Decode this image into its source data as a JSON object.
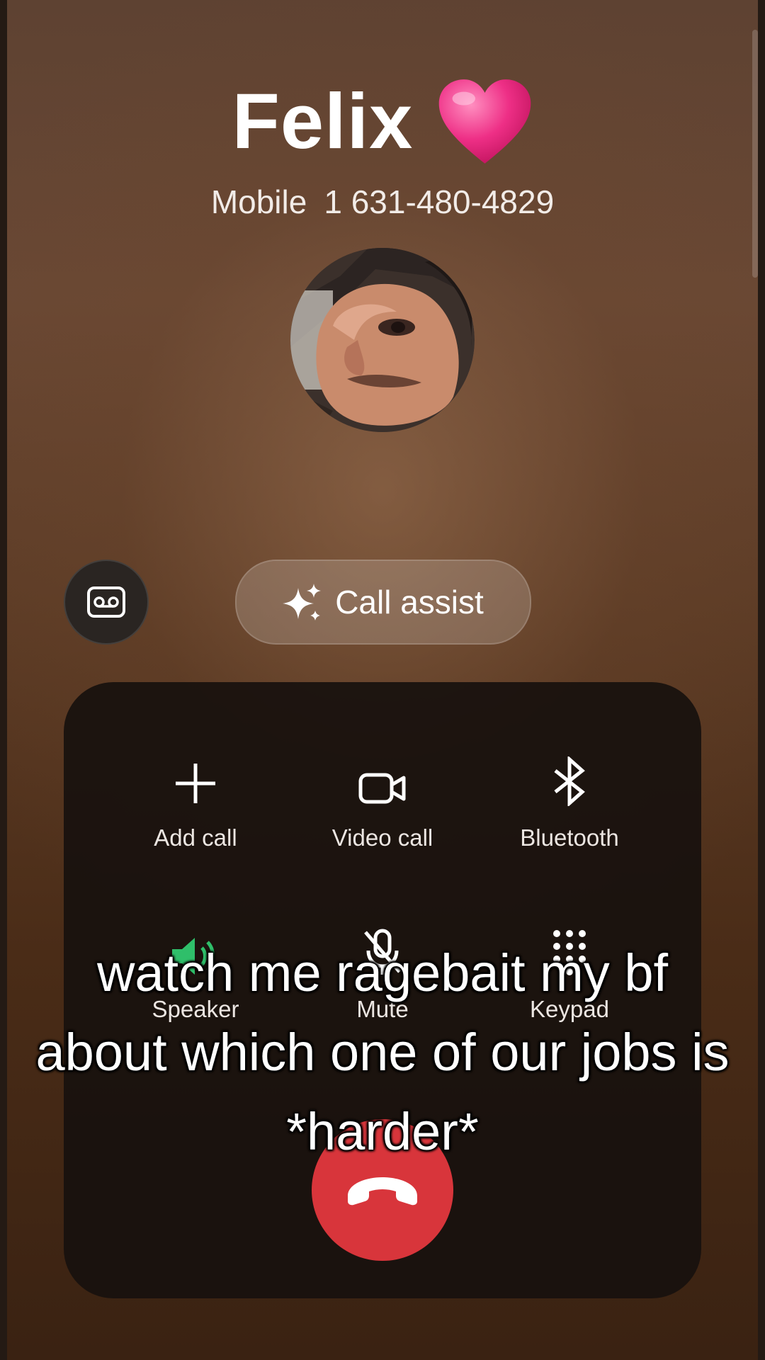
{
  "contact": {
    "name": "Felix",
    "number_label": "Mobile",
    "number": "1 631-480-4829",
    "heart_color": "#e8247c"
  },
  "actions": {
    "voicemail_icon": "voicemail-icon",
    "call_assist_label": "Call assist"
  },
  "controls": [
    {
      "label": "Add call",
      "icon": "plus-icon"
    },
    {
      "label": "Video call",
      "icon": "video-camera-icon"
    },
    {
      "label": "Bluetooth",
      "icon": "bluetooth-icon"
    },
    {
      "label": "Speaker",
      "icon": "speaker-icon"
    },
    {
      "label": "Mute",
      "icon": "mic-off-icon"
    },
    {
      "label": "Keypad",
      "icon": "keypad-icon"
    }
  ],
  "end_call": {
    "icon": "end-call-icon",
    "color": "#d8353b"
  },
  "caption": {
    "text": "watch me ragebait my bf about which one of our jobs is *harder*"
  },
  "colors": {
    "speaker_active": "#2fbf6a",
    "panel": "#18110e"
  }
}
